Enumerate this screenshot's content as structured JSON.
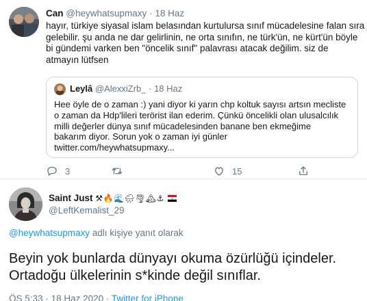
{
  "parent_tweet": {
    "author_name": "Can",
    "author_handle": "@heywhatsupmaxy",
    "separator": "·",
    "date": "18 Haz",
    "text_lines": [
      "hayır, türkiye siyasal islam belasından kurtulursa sınıf mücadelesine falan sıra",
      "gelebilir. şu anda ne dar gelirlinin, ne orta sınıfın, ne türk'ün, ne kürt'ün böyle",
      "bi gündemi varken ben \"öncelik sınıf\" palavrası atacak değilim. siz de",
      "atmayın lütfsen"
    ],
    "quoted": {
      "author_name": "Leylâ",
      "author_handle": "@AlexxiZrb_",
      "separator": "·",
      "date": "18 Haz",
      "text_lines": [
        "Hee öyle de o zaman :) yani diyor ki yarın chp koltuk sayısı artsın mecliste",
        "o zaman da Hdp'lileri terörist ilan ederim. Çünkü öncelikli olan ulusalcılık",
        "milli değerler dünya sınıf mücadelesinden banane ben ekmeğime",
        "bakarım diyor. Sorun yok o zaman iyi günler",
        "twitter.com/heywhatsupmaxy..."
      ]
    },
    "actions": {
      "reply_count": "3",
      "retweet_count": "",
      "like_count": "15"
    }
  },
  "main_tweet": {
    "author_name": "Saint Just",
    "author_emojis": "⚒🔥🌊🌧🌪🏔⚓",
    "author_handle": "@LeftKemalist_29",
    "reply_to_handle": "@heywhatsupmaxy",
    "reply_to_suffix": " adlı kişiye yanıt olarak",
    "text_lines": [
      "Beyin yok bunlarda dünyayı okuma özürlüğü içindeler.",
      "Ortadoğu ülkelerinin s*kinde değil sınıflar."
    ],
    "time": "ÖS 5:33",
    "date": "18 Haz 2020",
    "source": "Twitter for iPhone"
  },
  "colors": {
    "link": "#1b95e0",
    "secondary_text": "#657786",
    "border": "#ccd6dd",
    "flag_red": "#ce1126",
    "flag_black": "#000000"
  },
  "icons": [
    "reply-icon",
    "retweet-icon",
    "like-icon",
    "share-icon"
  ]
}
